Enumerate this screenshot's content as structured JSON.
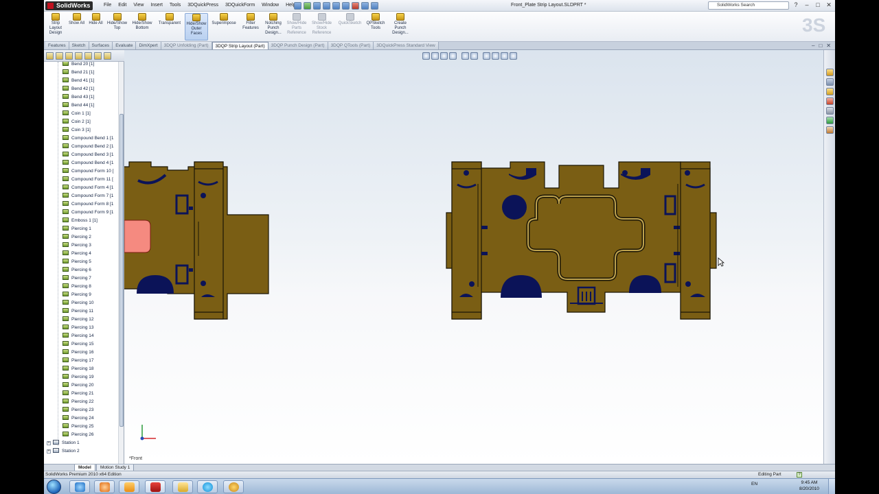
{
  "app": {
    "logo": "SolidWorks",
    "document_title": "Front_Plate Strip Layout.SLDPRT *"
  },
  "menu": [
    "File",
    "Edit",
    "View",
    "Insert",
    "Tools",
    "3DQuickPress",
    "3DQuickForm",
    "Window",
    "Help"
  ],
  "search": {
    "placeholder": "SolidWorks Search"
  },
  "window_buttons": [
    "?",
    "–",
    "□",
    "✕"
  ],
  "commands": [
    {
      "label": "Strip Layout Design"
    },
    {
      "label": "Show All"
    },
    {
      "label": "Hide All"
    },
    {
      "label": "Hide/Show Top"
    },
    {
      "label": "Hide/Show Bottom"
    },
    {
      "label": "Transparent"
    },
    {
      "label": "Hide/Show Outer Faces",
      "active": true
    },
    {
      "label": "Superimpose"
    },
    {
      "label": "Filter Features"
    },
    {
      "label": "Notching Punch Design..."
    },
    {
      "label": "Show/Hide Parts Reference",
      "dim": true
    },
    {
      "label": "Show/Hide Stock Reference",
      "dim": true
    },
    {
      "label": "QuickSketch",
      "dim": true
    },
    {
      "label": "QPSketch Tools"
    },
    {
      "label": "Create Punch Design..."
    }
  ],
  "tabs": [
    {
      "label": "Features"
    },
    {
      "label": "Sketch"
    },
    {
      "label": "Surfaces"
    },
    {
      "label": "Evaluate"
    },
    {
      "label": "DimXpert"
    },
    {
      "label": "3DQP Unfolding (Part)",
      "dim": true
    },
    {
      "label": "3DQP Strip Layout (Part)",
      "active": true
    },
    {
      "label": "3DQP Punch Design (Part)",
      "dim": true
    },
    {
      "label": "3DQP QTools (Part)",
      "dim": true
    },
    {
      "label": "3DQuickPress Standard View",
      "dim": true
    }
  ],
  "doc_controls": [
    "–",
    "□",
    "✕"
  ],
  "tree_items": [
    "Bend 20 [1]",
    "Bend 21 [1]",
    "Bend 41 [1]",
    "Bend 42 [1]",
    "Bend 43 [1]",
    "Bend 44 [1]",
    "Coin 1 [1]",
    "Coin 2 [1]",
    "Coin 3 [1]",
    "Compound Bend 1 [1",
    "Compound Bend 2 [1",
    "Compound Bend 3 [1",
    "Compound Bend 4 [1",
    "Compound Form 10 [",
    "Compound Form 11 [",
    "Compound Form 4 [1",
    "Compound Form 7 [1",
    "Compound Form 8 [1",
    "Compound Form 9 [1",
    "Emboss 1 [1]",
    "Piercing 1",
    "Piercing 2",
    "Piercing 3",
    "Piercing 4",
    "Piercing 5",
    "Piercing 6",
    "Piercing 7",
    "Piercing 8",
    "Piercing 9",
    "Piercing 10",
    "Piercing 11",
    "Piercing 12",
    "Piercing 13",
    "Piercing 14",
    "Piercing 15",
    "Piercing 16",
    "Piercing 17",
    "Piercing 18",
    "Piercing 19",
    "Piercing 20",
    "Piercing 21",
    "Piercing 22",
    "Piercing 23",
    "Piercing 24",
    "Piercing 25",
    "Piercing 26"
  ],
  "tree_stations": [
    "Station 1",
    "Station 2"
  ],
  "viewport": {
    "orientation": "*Front"
  },
  "bottom_tabs": [
    {
      "label": "Model",
      "active": true
    },
    {
      "label": "Motion Study 1"
    }
  ],
  "status": {
    "left": "SolidWorks Premium 2010 x64 Edition",
    "right": "Editing Part"
  },
  "taskbar": {
    "language": "EN",
    "time": "9:45 AM",
    "date": "8/20/2010"
  },
  "colors": {
    "part_fill": "#7a5e14",
    "part_edge": "#1a1506",
    "cut_fill": "#0b1358",
    "highlight": "#f58a80"
  }
}
